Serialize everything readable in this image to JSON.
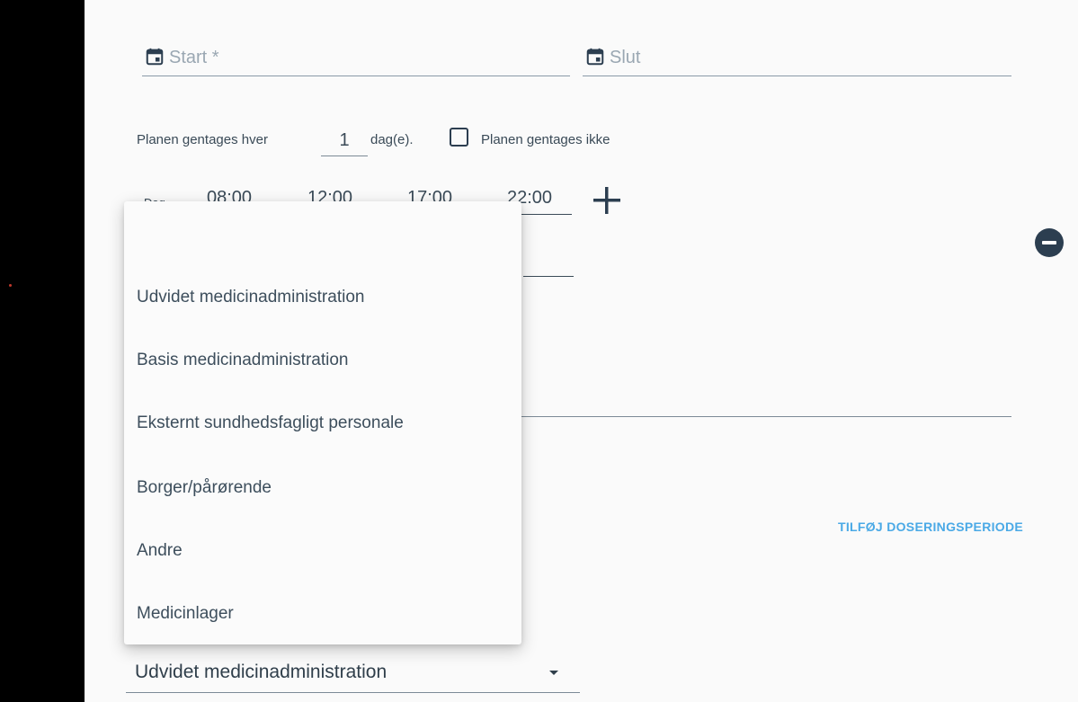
{
  "form": {
    "start_placeholder": "Start *",
    "end_placeholder": "Slut",
    "repeat_prefix": "Planen gentages hver",
    "repeat_interval": "1",
    "repeat_unit": "dag(e).",
    "no_repeat_label": "Planen gentages ikke",
    "time_row_label": "Dag",
    "times": [
      "08:00",
      "12:00",
      "17:00",
      "22:00"
    ],
    "add_period_label": "TILFØJ DOSERINGSPERIODE"
  },
  "menu": {
    "items": [
      "Udvidet medicinadministration",
      "Basis medicinadministration",
      "Eksternt sundhedsfagligt personale",
      "Borger/pårørende",
      "Andre",
      "Medicinlager"
    ]
  },
  "select": {
    "value": "Udvidet medicinadministration"
  },
  "icons": {
    "calendar": "calendar-icon",
    "plus": "plus-icon",
    "remove": "minus-circle-icon",
    "dropdown": "chevron-down-icon"
  },
  "colors": {
    "accent_link": "#4aa9e6",
    "icon_dark": "#2c3e50",
    "text": "#3a4a57"
  }
}
